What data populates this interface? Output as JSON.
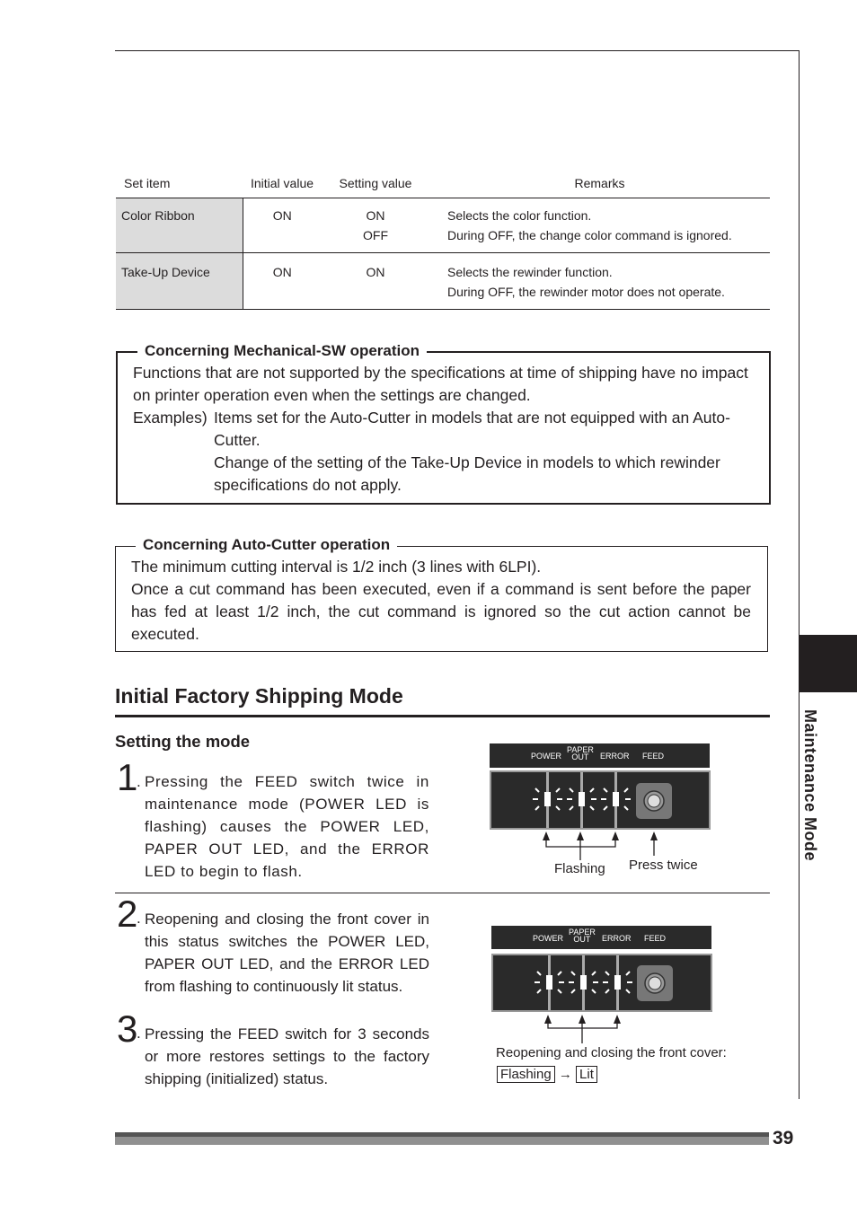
{
  "side_tab": {
    "label": "Maintenance Mode"
  },
  "settings_table": {
    "headers": [
      "Set item",
      "Initial value",
      "Setting value",
      "Remarks"
    ],
    "rows": [
      {
        "item": "Color Ribbon",
        "initial": "ON",
        "setting": [
          "ON",
          "OFF"
        ],
        "remarks": [
          "Selects the color function.",
          "During OFF, the change color command is ignored."
        ]
      },
      {
        "item": "Take-Up Device",
        "initial": "ON",
        "setting": [
          "ON"
        ],
        "remarks": [
          "Selects the rewinder function.",
          "During OFF, the rewinder motor does not operate."
        ]
      }
    ]
  },
  "note_mechanical": {
    "title": "Concerning Mechanical-SW operation",
    "text": "Functions that are not supported by the specifications at time of shipping have no impact on printer operation even when the settings are changed.",
    "examples_label": "Examples)",
    "examples": [
      "Items set for the Auto-Cutter in models that are not equipped with an Auto-Cutter.",
      "Change of the setting of the Take-Up Device in models to which rewinder specifications do not apply."
    ]
  },
  "note_autocutter": {
    "title": "Concerning Auto-Cutter operation",
    "lines": [
      "The minimum cutting interval is 1/2 inch (3 lines with 6LPI).",
      "Once a cut command has been executed, even if a command is sent before the paper has fed at least 1/2 inch, the cut command is ignored so the cut action cannot be executed."
    ]
  },
  "section": {
    "title": "Initial Factory Shipping Mode",
    "subtitle": "Setting the mode",
    "steps": [
      {
        "num": "1",
        "text": "Pressing the FEED switch twice in maintenance mode (POWER LED is flashing) causes the POWER LED, PAPER OUT LED, and the ERROR LED to begin to flash."
      },
      {
        "num": "2",
        "text": "Reopening and closing the front cover in this status switches the POWER LED, PAPER OUT LED, and the ERROR LED from flashing to continuously lit status."
      },
      {
        "num": "3",
        "text": "Pressing the FEED switch for 3 seconds or more restores settings to the factory shipping (initialized) status."
      }
    ]
  },
  "panel": {
    "labels": {
      "power": "POWER",
      "paper_out_1": "PAPER",
      "paper_out_2": "OUT",
      "error": "ERROR",
      "feed": "FEED"
    }
  },
  "figure1": {
    "flashing": "Flashing",
    "press_twice": "Press twice"
  },
  "figure2": {
    "caption": "Reopening and closing the front cover:",
    "from": "Flashing",
    "arrow": "→",
    "to": "Lit"
  },
  "page_number": "39"
}
